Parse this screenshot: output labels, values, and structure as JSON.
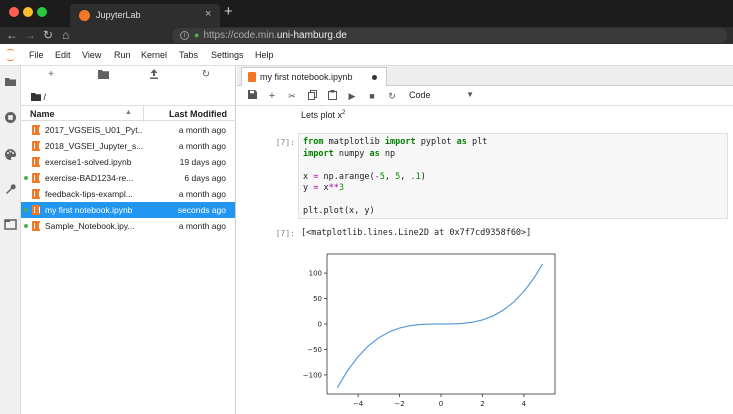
{
  "browser": {
    "tab_title": "JupyterLab",
    "url_prefix": "https://code.min.",
    "url_host": "uni-hamburg.de",
    "new_tab_label": "+",
    "tab_close_label": "×"
  },
  "menubar": {
    "items": [
      "File",
      "Edit",
      "View",
      "Run",
      "Kernel",
      "Tabs",
      "Settings",
      "Help"
    ]
  },
  "filebrowser": {
    "breadcrumb": "/",
    "col_name": "Name",
    "col_modified": "Last Modified",
    "files": [
      {
        "name": "2017_VGSEIS_U01_Pyt...",
        "modified": "a month ago",
        "running": false,
        "selected": false
      },
      {
        "name": "2018_VGSEI_Jupyter_s...",
        "modified": "a month ago",
        "running": false,
        "selected": false
      },
      {
        "name": "exercise1-solved.ipynb",
        "modified": "19 days ago",
        "running": false,
        "selected": false
      },
      {
        "name": "exercise-BAD1234-re...",
        "modified": "6 days ago",
        "running": true,
        "selected": false
      },
      {
        "name": "feedback-tips-exampl...",
        "modified": "a month ago",
        "running": false,
        "selected": false
      },
      {
        "name": "my first notebook.ipynb",
        "modified": "seconds ago",
        "running": true,
        "selected": true
      },
      {
        "name": "Sample_Notebook.ipy...",
        "modified": "a month ago",
        "running": true,
        "selected": false
      }
    ]
  },
  "notebook": {
    "tab_title": "my first notebook.ipynb",
    "cell_type": "Code",
    "markdown_text": "Lets plot x",
    "markdown_sup": "2",
    "code_prompt": "[7]:",
    "output_prompt": "[7]:",
    "code_lines": [
      {
        "parts": [
          [
            "kw",
            "from"
          ],
          [
            "t",
            " matplotlib "
          ],
          [
            "kw",
            "import"
          ],
          [
            "t",
            " pyplot "
          ],
          [
            "kw",
            "as"
          ],
          [
            "t",
            " plt"
          ]
        ]
      },
      {
        "parts": [
          [
            "kw",
            "import"
          ],
          [
            "t",
            " numpy "
          ],
          [
            "kw",
            "as"
          ],
          [
            "t",
            " np"
          ]
        ]
      },
      {
        "parts": [
          [
            "t",
            ""
          ]
        ]
      },
      {
        "parts": [
          [
            "t",
            "x "
          ],
          [
            "op",
            "="
          ],
          [
            "t",
            " np.arange("
          ],
          [
            "op",
            "-"
          ],
          [
            "num",
            "5"
          ],
          [
            "t",
            ", "
          ],
          [
            "num",
            "5"
          ],
          [
            "t",
            ", "
          ],
          [
            "num",
            ".1"
          ],
          [
            "t",
            ")"
          ]
        ]
      },
      {
        "parts": [
          [
            "t",
            "y "
          ],
          [
            "op",
            "="
          ],
          [
            "t",
            " x"
          ],
          [
            "op",
            "**"
          ],
          [
            "num",
            "3"
          ]
        ]
      },
      {
        "parts": [
          [
            "t",
            ""
          ]
        ]
      },
      {
        "parts": [
          [
            "t",
            "plt.plot(x, y)"
          ]
        ]
      }
    ],
    "output_text": "[<matplotlib.lines.Line2D at 0x7f7cd9358f60>]"
  },
  "chart_data": {
    "type": "line",
    "title": "",
    "xlabel": "",
    "ylabel": "",
    "xlim": [
      -5.5,
      5.5
    ],
    "ylim": [
      -137.5,
      137.5
    ],
    "xticks": [
      -4,
      -2,
      0,
      2,
      4
    ],
    "yticks": [
      -100,
      -50,
      0,
      50,
      100
    ],
    "series": [
      {
        "color": "#5b9bd5",
        "x": [
          -5,
          -4.5,
          -4,
          -3.5,
          -3,
          -2.5,
          -2,
          -1.5,
          -1,
          -0.5,
          0,
          0.5,
          1,
          1.5,
          2,
          2.5,
          3,
          3.5,
          4,
          4.5,
          4.9
        ],
        "y": [
          -125,
          -91.125,
          -64,
          -42.875,
          -27,
          -15.625,
          -8,
          -3.375,
          -1,
          -0.125,
          0,
          0.125,
          1,
          3.375,
          8,
          15.625,
          27,
          42.875,
          64,
          91.125,
          117.649
        ]
      }
    ]
  }
}
